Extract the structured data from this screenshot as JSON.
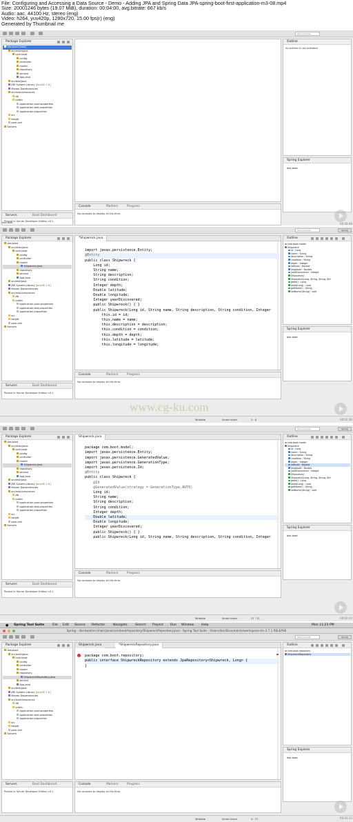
{
  "info": {
    "lines": [
      "File: Configuring and Accessing a Data Source - Demo - Adding JPA and Spring Data JPA-spring-boot-first-application-m3-08.mp4",
      "Size: 20001246 bytes (19.07 MiB), duration: 00:04:00, avg.bitrate: 667 kb/s",
      "Audio: aac, 44100 Hz, stereo (eng)",
      "Video: h264, yuv420p, 1280x720, 15.00 fps(r) (eng)",
      "Generated by Thumbnail me"
    ]
  },
  "common": {
    "package_explorer": "Package Explorer",
    "outline": "Outline",
    "spring_explorer": "Spring Explorer",
    "console": "Console",
    "markers": "Markers",
    "progress": "Progress",
    "no_consoles": "No consoles to display at this time.",
    "servers": "Servers",
    "boot_dashboard": "Boot Dashboard",
    "pivotal_server": "Pivotal tc Server Developer Edition v3.1",
    "das_boot": "das-boot",
    "quick_access": "Quick Access",
    "spring_persp": "Spring",
    "writable": "Writable",
    "smart_insert": "Smart Insert",
    "outline_na": "An outline is not available.",
    "watermark": "www.cg-ku.com"
  },
  "f1": {
    "tree": [
      "das-boot [boot]",
      "src/main/java",
      "com.boot",
      "config",
      "controller",
      "model",
      "repository",
      "service",
      "App.java",
      "src/test/java",
      "JRE System Library",
      "[JavaSE-1.8]",
      "Maven Dependencies",
      "src/main/resources",
      "db",
      "public",
      "application-prod.properties",
      "application-test.properties",
      "application.properties",
      "src",
      "target",
      "pom.xml",
      "Servers"
    ],
    "footer": "das-boot",
    "timestamp": "00:00:48"
  },
  "f2": {
    "tree": [
      "das-boot",
      "src/main/java",
      "com.boot",
      "config",
      "controller",
      "model",
      "Shipwreck.java",
      "repository",
      "service",
      "App.java",
      "src/test/java",
      "JRE System Library",
      "[JavaSE-1.8]",
      "Maven Dependencies",
      "src/main/resources",
      "db",
      "public",
      "application-prod.properties",
      "application-test.properties",
      "application.properties",
      "src",
      "target",
      "pom.xml",
      "Servers"
    ],
    "tab": "*Shipwreck.java",
    "code": [
      "import javax.persistence.Entity;",
      "",
      "@Entity",
      "public class Shipwreck {",
      "    Long id;",
      "    String name;",
      "    String description;",
      "    String condition;",
      "    Integer depth;",
      "    Double latitude;",
      "    Double longitude;",
      "    Integer yearDiscovered;",
      "",
      "    public Shipwreck() { }",
      "",
      "    public Shipwreck(Long id, String name, String description, String condition, Integer",
      "        this.id = id;",
      "        this.name = name;",
      "        this.description = description;",
      "        this.condition = condition;",
      "        this.depth = depth;",
      "        this.latitude = latitude;",
      "        this.longitude = longitude;"
    ],
    "outline": [
      "com.boot.model",
      "Shipwreck",
      "id : Long",
      "name : String",
      "description : String",
      "condition : String",
      "depth : Integer",
      "latitude : Double",
      "longitude : Double",
      "yearDiscovered : Integer",
      "Shipwreck()",
      "Shipwreck(Long, String, String, Stri",
      "getId() : Long",
      "setId(Long) : void",
      "getName() : String",
      "setName(String) : void"
    ],
    "status_pos": "5 : 8",
    "timestamp": "00:01:36"
  },
  "f3": {
    "tree": [
      "das-boot",
      "src/main/java",
      "com.boot",
      "config",
      "controller",
      "model",
      "Shipwreck.java",
      "repository",
      "service",
      "App.java",
      "src/test/java",
      "JRE System Library",
      "[JavaSE-1.8]",
      "Maven Dependencies",
      "src/main/resources",
      "db",
      "public",
      "application-prod.properties",
      "application-test.properties",
      "application.properties",
      "src",
      "target",
      "pom.xml",
      "Servers"
    ],
    "tab": "Shipwreck.java",
    "code": [
      "package com.boot.model;",
      "",
      "import javax.persistence.Entity;",
      "import javax.persistence.GeneratedValue;",
      "import javax.persistence.GenerationType;",
      "import javax.persistence.Id;",
      "",
      "@Entity",
      "public class Shipwreck {",
      "    @Id",
      "    @GeneratedValue(strategy = GenerationType.AUTO)",
      "    Long id;",
      "    String name;",
      "    String description;",
      "    String condition;",
      "    Integer depth;",
      "    Double latitude;",
      "    Double longitude;",
      "    Integer yearDiscovered;",
      "",
      "    public Shipwreck() { }",
      "",
      "    public Shipwreck(Long id, String name, String description, String condition, Integer"
    ],
    "outline": [
      "com.boot.model",
      "Shipwreck",
      "id : Long",
      "name : String",
      "description : String",
      "condition : String",
      "depth : Integer",
      "latitude : Double",
      "longitude : Double",
      "yearDiscovered : Integer",
      "Shipwreck()",
      "Shipwreck(Long, String, String, Stri",
      "getId() : Long",
      "setId(Long) : void",
      "getName() : String",
      "setName(String) : void"
    ],
    "status_pos": "17 : 21",
    "timestamp": "00:02:24"
  },
  "f4": {
    "menubar": {
      "app": "Spring Tool Suite",
      "menus": [
        "File",
        "Edit",
        "Source",
        "Refactor",
        "Navigate",
        "Search",
        "Project",
        "Run",
        "Window",
        "Help"
      ],
      "clock": "Mon 11:23 PM"
    },
    "window_title": "Spring - das-boot/src/main/java/com/boot/repository/ShipwreckRepository.java - Spring Tool Suite - /Users/dan/Documents/workspace-sts-3.7.1.RELEASE",
    "tree": [
      "das-boot",
      "src/main/java",
      "com.boot",
      "config",
      "controller",
      "model",
      "repository",
      "ShipwreckRepository.java",
      "service",
      "App.java",
      "src/test/java",
      "JRE System Library",
      "[JavaSE-1.8]",
      "Maven Dependencies",
      "src/main/resources",
      "db",
      "public",
      "application-prod.properties",
      "application-test.properties",
      "application.properties",
      "src",
      "target",
      "pom.xml",
      "Servers"
    ],
    "tab1": "Shipwreck.java",
    "tab2": "*ShipwreckRepository.java",
    "code": [
      "package com.boot.repository;",
      "",
      "public interface ShipwreckRepository extends JpaRepository<Shipwreck, Long> {",
      "",
      "}"
    ],
    "outline": [
      "com.boot.repository",
      "ShipwreckRepository"
    ],
    "status_pos": "3 : 77",
    "timestamp": "00:03:12"
  }
}
